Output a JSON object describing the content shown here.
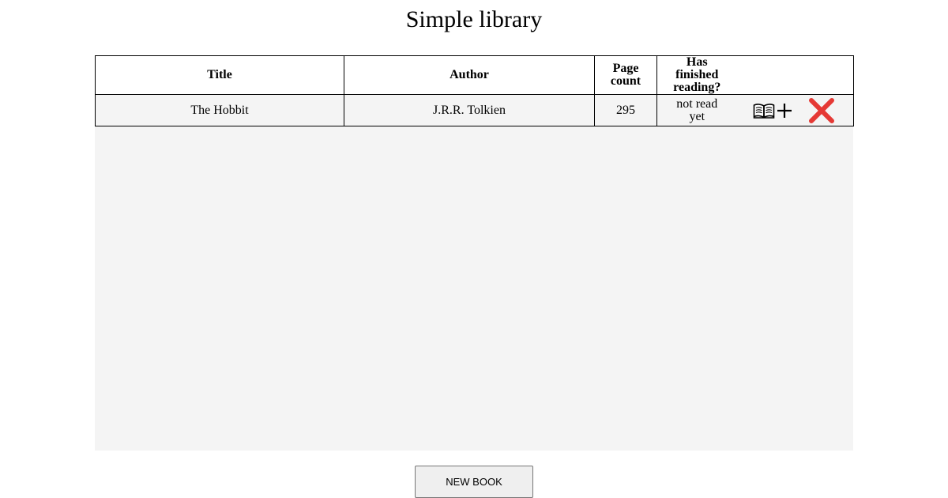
{
  "page": {
    "title": "Simple library"
  },
  "table": {
    "headers": {
      "title": "Title",
      "author": "Author",
      "page_count_line1": "Page",
      "page_count_line2": "count",
      "finished_line1": "Has",
      "finished_line2": "finished",
      "finished_line3": "reading?"
    },
    "rows": [
      {
        "title": "The Hobbit",
        "author": "J.R.R. Tolkien",
        "page_count": "295",
        "status_line1": "not read",
        "status_line2": "yet",
        "icons": {
          "read_toggle": "open-book-plus-icon",
          "delete": "red-x-icon"
        }
      }
    ]
  },
  "footer": {
    "new_book_label": "NEW BOOK"
  },
  "colors": {
    "panel_background": "#f4f4f4",
    "delete_icon": "#e53935",
    "button_background": "#efefef"
  }
}
